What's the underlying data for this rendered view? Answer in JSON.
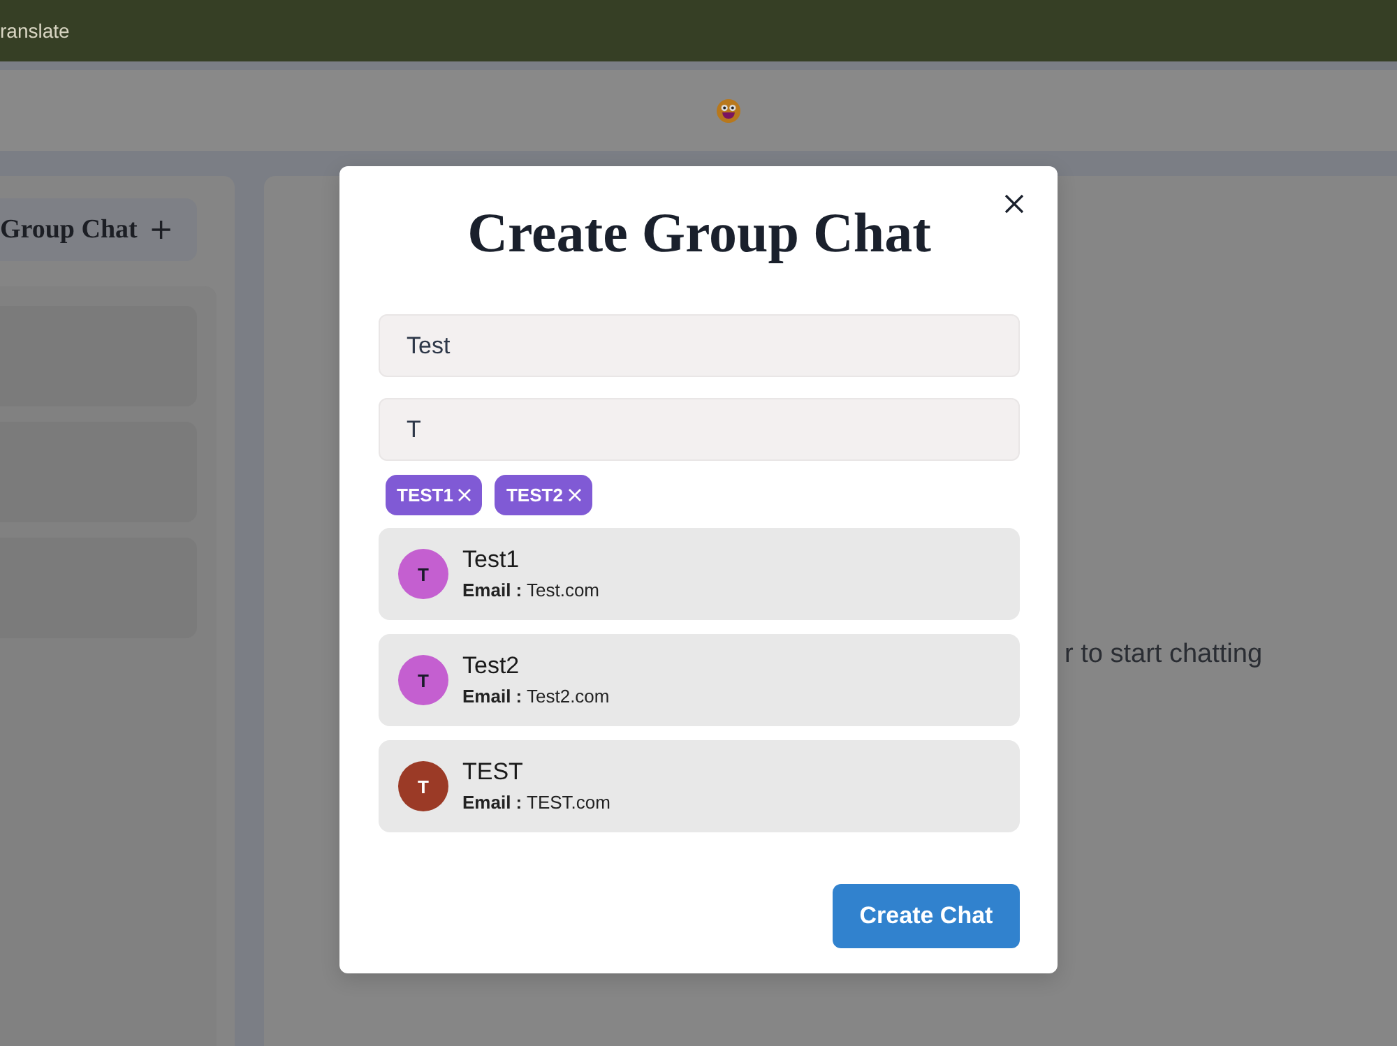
{
  "top_bar": {
    "text": "ranslate"
  },
  "sidebar": {
    "new_group_button": "Group Chat",
    "chats": [
      {
        "selected": false
      },
      {
        "selected": false
      },
      {
        "selected": false
      }
    ]
  },
  "chat_panel": {
    "hint": "r to start chatting"
  },
  "modal": {
    "title": "Create Group Chat",
    "fields": [
      {
        "value": "Test"
      },
      {
        "value": "T"
      }
    ],
    "selected_users": [
      {
        "label": "TEST1"
      },
      {
        "label": "TEST2"
      }
    ],
    "search_results": [
      {
        "initial": "T",
        "color": "#c45fd0",
        "name": "Test1",
        "email": "**Email :** Test.com"
      },
      {
        "initial": "T",
        "color": "#c45fd0",
        "name": "Test2",
        "email": "**Email :** Test2.com"
      },
      {
        "initial": "T",
        "color": "#9b3a26",
        "name": "TEST",
        "email": "**Email :** TEST.com"
      }
    ],
    "submit_button": "Create Chat"
  }
}
